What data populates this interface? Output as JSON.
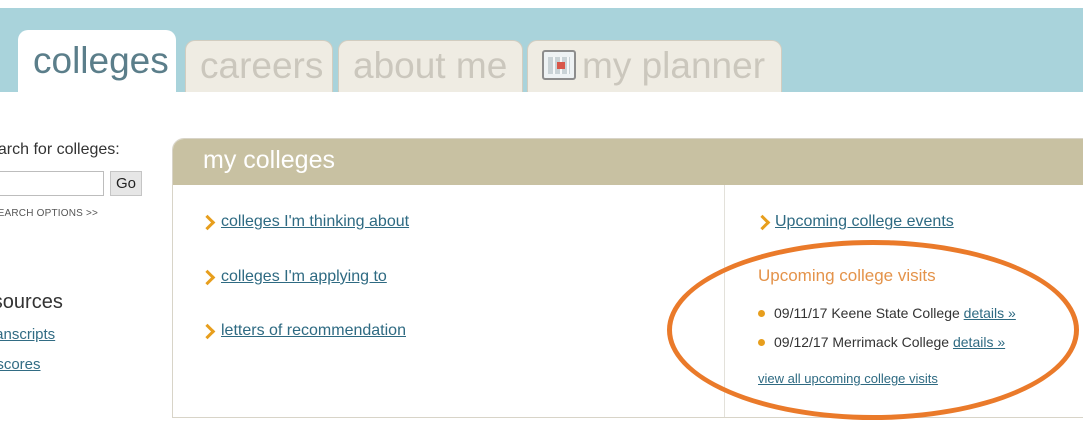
{
  "tabs": [
    {
      "label": "colleges",
      "active": true
    },
    {
      "label": "careers",
      "active": false
    },
    {
      "label": "about me",
      "active": false
    },
    {
      "label": "my planner",
      "active": false,
      "icon": "planner-calendar-icon"
    }
  ],
  "left": {
    "search_label": "search for colleges:",
    "go_label": "Go",
    "search_value": "",
    "advanced_label": "MORE SEARCH OPTIONS >>",
    "resources_title": "resources",
    "resource_links": [
      "transcripts",
      "test scores"
    ]
  },
  "panel": {
    "title": "my colleges",
    "links": [
      "colleges I'm thinking about",
      "colleges I'm applying to",
      "letters of recommendation"
    ],
    "events_link": "Upcoming college events",
    "visits_title": "Upcoming college visits",
    "visits": [
      {
        "text": "09/11/17 Keene State College",
        "link": "details »"
      },
      {
        "text": "09/12/17 Merrimack College",
        "link": "details »"
      }
    ],
    "view_all": "view all upcoming college visits"
  },
  "colors": {
    "header_band": "#a9d3db",
    "panel_header": "#c8c1a2",
    "link": "#2e6a82",
    "accent_orange": "#e79e1d",
    "highlight_circle": "#ea7a2a"
  }
}
